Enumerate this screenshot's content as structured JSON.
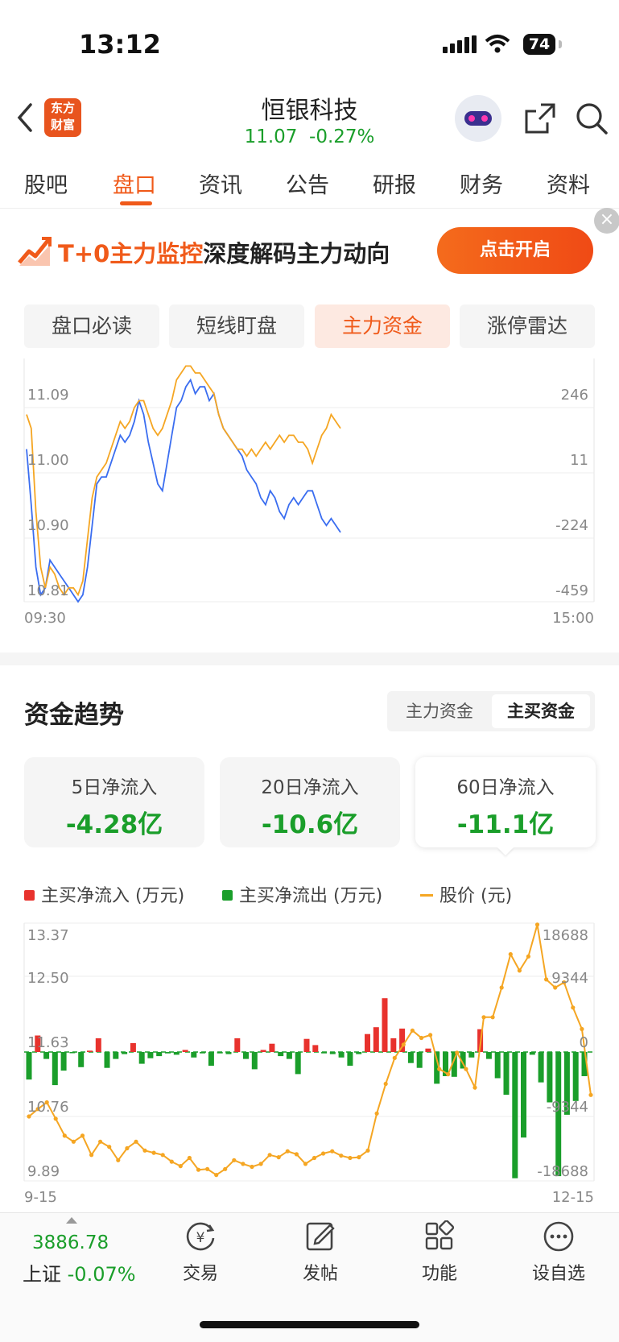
{
  "status_bar": {
    "time": "13:12",
    "battery": "74"
  },
  "header": {
    "logo_line1": "东方",
    "logo_line2": "财富",
    "stock_name": "恒银科技",
    "price": "11.07",
    "change_pct": "-0.27%"
  },
  "tabs": [
    "股吧",
    "盘口",
    "资讯",
    "公告",
    "研报",
    "财务",
    "资料"
  ],
  "active_tab": "盘口",
  "banner": {
    "title_orange": "T+0主力监控",
    "title_black": "深度解码主力动向",
    "button": "点击开启",
    "close": "×"
  },
  "subtabs": [
    "盘口必读",
    "短线盯盘",
    "主力资金",
    "涨停雷达"
  ],
  "active_subtab": "主力资金",
  "intraday_chart": {
    "left_ticks": [
      "11.09",
      "11.00",
      "10.90",
      "10.81"
    ],
    "right_ticks": [
      "246",
      "11",
      "-224",
      "-459"
    ],
    "x_start": "09:30",
    "x_end": "15:00"
  },
  "fund_trend": {
    "title": "资金趋势",
    "toggle": [
      "主力资金",
      "主买资金"
    ],
    "toggle_active": "主买资金",
    "cards": [
      {
        "label": "5日净流入",
        "value": "-4.28亿"
      },
      {
        "label": "20日净流入",
        "value": "-10.6亿"
      },
      {
        "label": "60日净流入",
        "value": "-11.1亿"
      }
    ],
    "legend": {
      "inflow": "主买净流入 (万元)",
      "outflow": "主买净流出 (万元)",
      "price": "股价 (元)"
    },
    "left_ticks": [
      "13.37",
      "12.50",
      "11.63",
      "10.76",
      "9.89"
    ],
    "right_ticks": [
      "18688",
      "9344",
      "0",
      "-9344",
      "-18688"
    ],
    "x_start": "9-15",
    "x_end": "12-15"
  },
  "chart_data": [
    {
      "type": "line",
      "x_range": [
        "09:30",
        "15:00"
      ],
      "price_range": [
        10.81,
        11.09
      ],
      "flow_range": [
        -459,
        246
      ],
      "series": [
        {
          "color": "#3a6df0",
          "values": [
            11.03,
            10.95,
            10.86,
            10.82,
            10.83,
            10.87,
            10.86,
            10.85,
            10.84,
            10.83,
            10.82,
            10.81,
            10.82,
            10.86,
            10.92,
            10.98,
            10.99,
            10.99,
            11.01,
            11.03,
            11.05,
            11.04,
            11.05,
            11.07,
            11.1,
            11.08,
            11.04,
            11.01,
            10.98,
            10.97,
            11.01,
            11.05,
            11.09,
            11.1,
            11.12,
            11.13,
            11.11,
            11.12,
            11.12,
            11.1,
            11.11,
            11.08,
            11.06,
            11.05,
            11.04,
            11.03,
            11.02,
            11.0,
            10.99,
            10.98,
            10.96,
            10.95,
            10.97,
            10.96,
            10.94,
            10.93,
            10.95,
            10.96,
            10.95,
            10.96,
            10.97,
            10.97,
            10.95,
            10.93,
            10.92,
            10.93,
            10.92,
            10.91
          ]
        },
        {
          "color": "#f5a623",
          "values": [
            11.08,
            11.06,
            10.94,
            10.86,
            10.83,
            10.86,
            10.85,
            10.83,
            10.82,
            10.83,
            10.83,
            10.82,
            10.84,
            10.9,
            10.96,
            10.99,
            11.0,
            11.01,
            11.03,
            11.05,
            11.07,
            11.06,
            11.07,
            11.09,
            11.1,
            11.1,
            11.08,
            11.06,
            11.05,
            11.06,
            11.08,
            11.1,
            11.13,
            11.14,
            11.15,
            11.15,
            11.14,
            11.14,
            11.13,
            11.12,
            11.11,
            11.08,
            11.06,
            11.05,
            11.04,
            11.03,
            11.03,
            11.02,
            11.03,
            11.02,
            11.03,
            11.04,
            11.03,
            11.04,
            11.05,
            11.04,
            11.05,
            11.05,
            11.04,
            11.04,
            11.03,
            11.01,
            11.03,
            11.05,
            11.06,
            11.08,
            11.07,
            11.06
          ]
        }
      ]
    },
    {
      "type": "bar",
      "x_range": [
        "9-15",
        "12-15"
      ],
      "price_range": [
        9.89,
        13.37
      ],
      "flow_range": [
        -18688,
        18688
      ],
      "series": [
        {
          "name": "主买净流入 (万元)",
          "color": "#e8322d",
          "values": [
            -4000,
            2400,
            -1000,
            -4800,
            -2700,
            -100,
            -2200,
            200,
            2000,
            -2300,
            -1000,
            -300,
            1300,
            -1700,
            -900,
            -600,
            -200,
            -400,
            300,
            -800,
            -200,
            -2000,
            -200,
            -300,
            2000,
            -1000,
            -2500,
            300,
            1200,
            -600,
            -1000,
            -3200,
            1900,
            1000,
            -200,
            -300,
            -800,
            -2000,
            -300,
            2600,
            3600,
            7800,
            2000,
            3400,
            -1600,
            -2300,
            500,
            -4600,
            -3500,
            -3600,
            -2400,
            -800,
            3300,
            -1000,
            -3800,
            -6200,
            -18300,
            -12400,
            -400,
            -4400,
            -7300,
            -18000,
            -9100,
            -7100,
            -3500
          ]
        },
        {
          "name": "股价 (元)",
          "color": "#f5a623",
          "values": [
            10.76,
            10.86,
            10.95,
            10.73,
            10.5,
            10.42,
            10.5,
            10.24,
            10.42,
            10.35,
            10.17,
            10.33,
            10.42,
            10.3,
            10.27,
            10.24,
            10.15,
            10.09,
            10.2,
            10.04,
            10.05,
            9.97,
            10.05,
            10.17,
            10.12,
            10.08,
            10.12,
            10.24,
            10.21,
            10.29,
            10.25,
            10.12,
            10.2,
            10.26,
            10.29,
            10.23,
            10.2,
            10.21,
            10.3,
            10.8,
            11.2,
            11.55,
            11.73,
            11.92,
            11.82,
            11.86,
            11.4,
            11.33,
            11.62,
            11.4,
            11.15,
            12.1,
            12.1,
            12.5,
            12.95,
            12.73,
            12.92,
            13.35,
            12.61,
            12.5,
            12.57,
            12.23,
            11.94,
            11.05
          ]
        }
      ]
    }
  ],
  "bottom_nav": {
    "index_value": "3886.78",
    "index_name": "上证",
    "index_change": "-0.07%",
    "items": [
      "交易",
      "发帖",
      "功能",
      "设自选"
    ]
  },
  "colors": {
    "accent": "#f05a1a",
    "down": "#1a9e2a",
    "up": "#e8322d",
    "price_line": "#f5a623",
    "flow_line": "#3a6df0"
  }
}
